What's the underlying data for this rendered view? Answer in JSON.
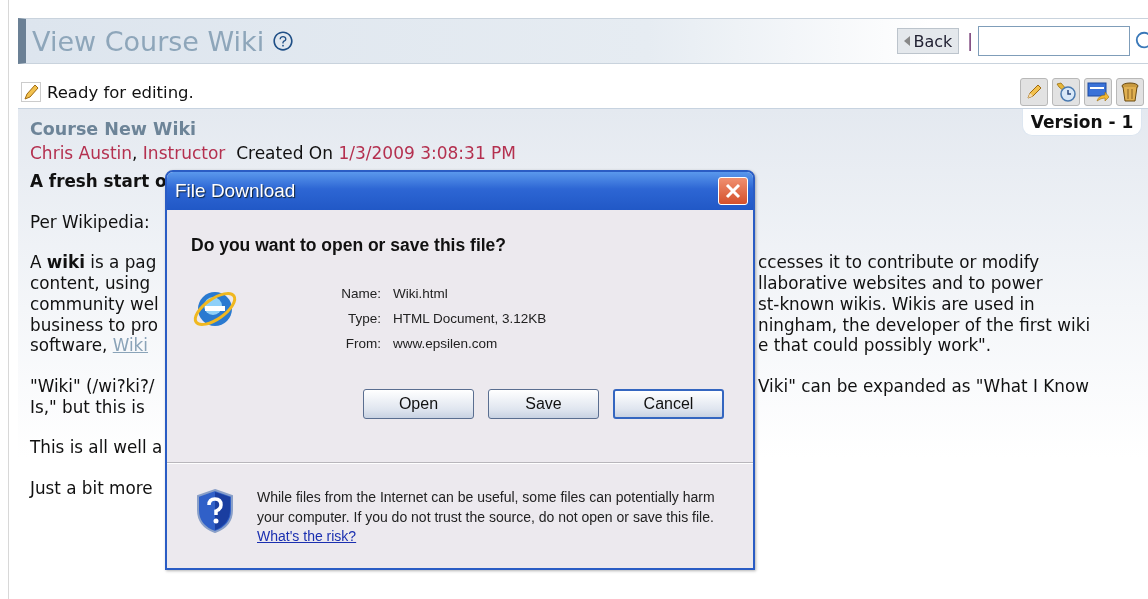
{
  "header": {
    "title": "View Course Wiki",
    "back_label": "Back",
    "separator": "|"
  },
  "status": "Ready for editing.",
  "toolbar": [
    {
      "kind": "edit"
    },
    {
      "kind": "history"
    },
    {
      "kind": "html"
    },
    {
      "kind": "delete"
    }
  ],
  "version": "Version - 1",
  "wiki": {
    "title": "Course New Wiki",
    "author": "Chris Austin",
    "comma": ",",
    "role": "Instructor",
    "created_label": "Created On",
    "created": "1/3/2009 3:08:31 PM",
    "paragraphs": [
      {
        "kind": "heading",
        "lines": [
          {
            "left": "A fresh start o"
          }
        ]
      },
      {
        "kind": "text",
        "lines": [
          {
            "left": "Per Wikipedia:"
          }
        ]
      },
      {
        "kind": "text",
        "lines": [
          {
            "left": "A **wiki** is a pag",
            "right": "ccesses it to contribute or modify"
          },
          {
            "left": "content, using",
            "right": "llaborative websites and to power"
          },
          {
            "left": "community wel",
            "right": "st-known wikis. Wikis are used in"
          },
          {
            "left": "business to pro",
            "right": "ningham, the developer of the first wiki"
          },
          {
            "left": "software, ",
            "link": "Wiki",
            "right": "e that could possibly work\"."
          }
        ]
      },
      {
        "kind": "text",
        "lines": [
          {
            "left": "\"Wiki\" (/wi?ki?/",
            "right": "Viki\" can be expanded as \"What I Know"
          },
          {
            "left": "Is,\" but this is"
          }
        ]
      },
      {
        "kind": "text",
        "lines": [
          {
            "left": "This is all well a"
          }
        ]
      },
      {
        "kind": "text",
        "lines": [
          {
            "left": "Just a bit more"
          }
        ]
      }
    ]
  },
  "dialog": {
    "title": "File Download",
    "question": "Do you want to open or save this file?",
    "fields": [
      {
        "label": "Name:",
        "value": "Wiki.html"
      },
      {
        "label": "Type:",
        "value": "HTML Document, 3.12KB"
      },
      {
        "label": "From:",
        "value": "www.epsilen.com"
      }
    ],
    "buttons": [
      {
        "label": "Open",
        "default": false
      },
      {
        "label": "Save",
        "default": false
      },
      {
        "label": "Cancel",
        "default": true
      }
    ],
    "warning": "While files from the Internet can be useful, some files can potentially harm your computer. If you do not trust the source, do not open or save this file.",
    "risk_link": "What's the risk?"
  }
}
